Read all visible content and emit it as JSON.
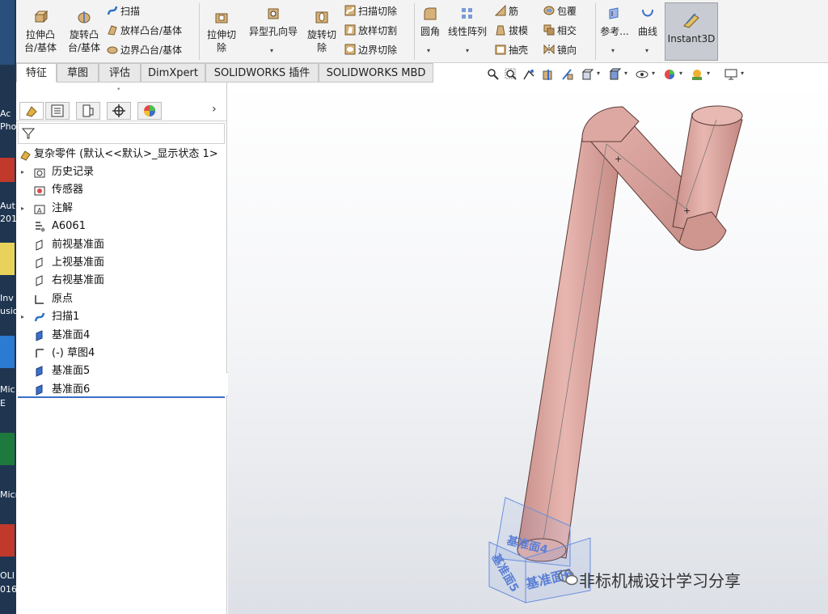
{
  "ribbon": {
    "extrude_boss": "拉伸凸\n台/基体",
    "revolve_boss": "旋转凸\n台/基体",
    "sweep": "扫描",
    "loft_boss": "放样凸台/基体",
    "boundary_boss": "边界凸台/基体",
    "extrude_cut": "拉伸切\n除",
    "hole_wizard": "异型孔向导",
    "revolve_cut": "旋转切\n除",
    "sweep_cut": "扫描切除",
    "loft_cut": "放样切割",
    "boundary_cut": "边界切除",
    "fillet": "圆角",
    "linear_pattern": "线性阵列",
    "rib": "筋",
    "draft": "拔模",
    "shell": "抽壳",
    "wrap": "包覆",
    "intersect": "相交",
    "mirror": "镜向",
    "reference": "参考...",
    "curves": "曲线",
    "instant3d": "Instant3D"
  },
  "tabs": [
    "特征",
    "草图",
    "评估",
    "DimXpert",
    "SOLIDWORKS 插件",
    "SOLIDWORKS MBD"
  ],
  "desktop": {
    "labels": [
      "Ac",
      "Pho",
      "Aut",
      "201",
      "Inv",
      "usic",
      "Mic",
      "E",
      "Micr",
      "OLI",
      "016"
    ]
  },
  "tree": {
    "root": "复杂零件 (默认<<默认>_显示状态 1>",
    "items": [
      {
        "label": "历史记录",
        "icon": "history-folder-icon",
        "expandable": true
      },
      {
        "label": "传感器",
        "icon": "sensor-folder-icon",
        "expandable": false
      },
      {
        "label": "注解",
        "icon": "annotation-folder-icon",
        "expandable": true
      },
      {
        "label": "A6061",
        "icon": "material-icon",
        "expandable": false
      },
      {
        "label": "前视基准面",
        "icon": "plane-icon",
        "expandable": false
      },
      {
        "label": "上视基准面",
        "icon": "plane-icon",
        "expandable": false
      },
      {
        "label": "右视基准面",
        "icon": "plane-icon",
        "expandable": false
      },
      {
        "label": "原点",
        "icon": "origin-icon",
        "expandable": false
      },
      {
        "label": "扫描1",
        "icon": "sweep-feature-icon",
        "expandable": true
      },
      {
        "label": "基准面4",
        "icon": "plane-filled-icon",
        "expandable": false
      },
      {
        "label": "(-) 草图4",
        "icon": "sketch-icon",
        "expandable": false
      },
      {
        "label": "基准面5",
        "icon": "plane-filled-icon",
        "expandable": false
      },
      {
        "label": "基准面6",
        "icon": "plane-filled-icon",
        "expandable": false
      }
    ]
  },
  "viewport": {
    "plane_labels": [
      "基准面4",
      "基准面5",
      "基准面6"
    ],
    "watermark": "非标机械设计学习分享"
  },
  "colors": {
    "pipe": "#d9a49e",
    "pipe_shade": "#b87f79",
    "plane": "#6b8fe0",
    "accent_blue": "#3a6fc8"
  }
}
